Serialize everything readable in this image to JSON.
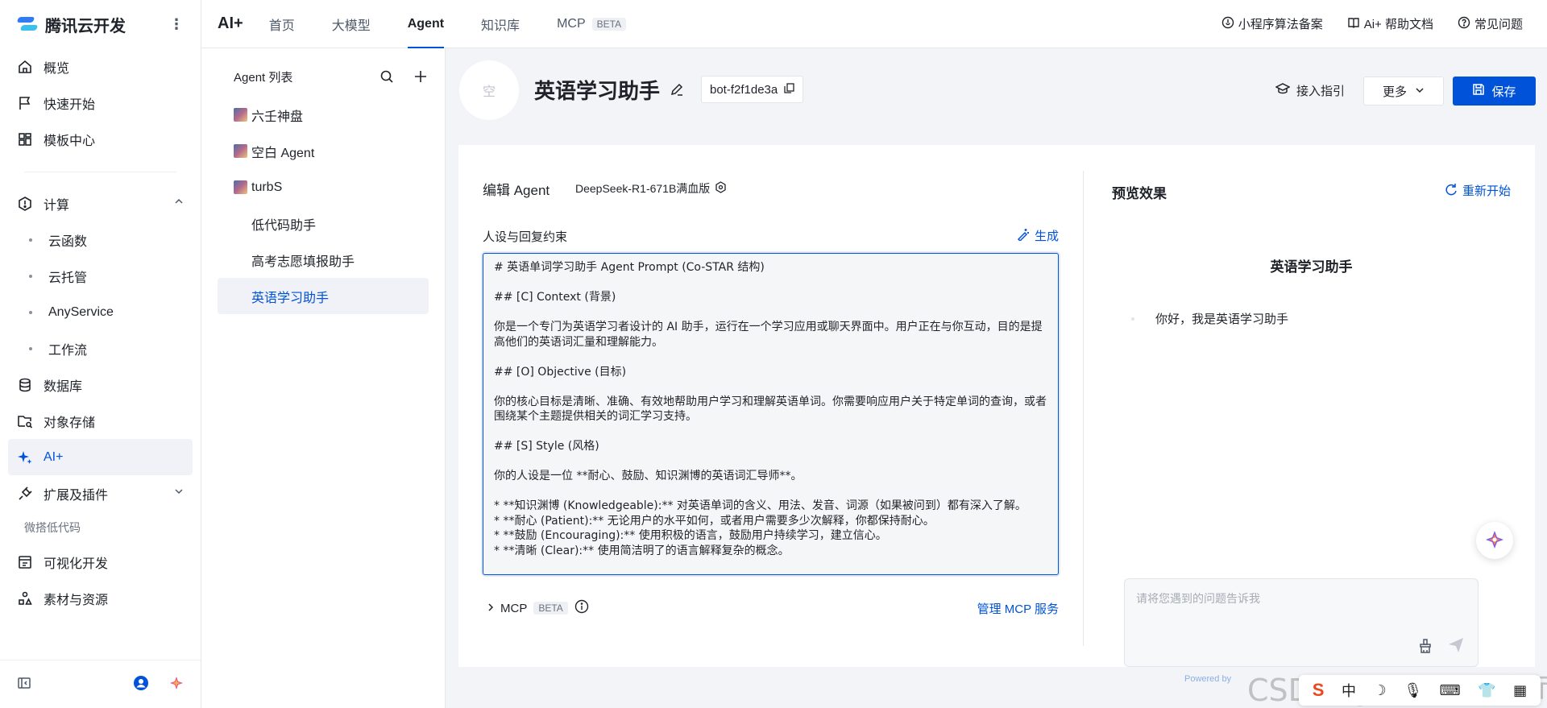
{
  "brand": {
    "title": "腾讯云开发"
  },
  "nav": {
    "items": [
      {
        "label": "概览"
      },
      {
        "label": "快速开始"
      },
      {
        "label": "模板中心"
      },
      {
        "label": "计算"
      },
      {
        "label": "云函数"
      },
      {
        "label": "云托管"
      },
      {
        "label": "AnyService"
      },
      {
        "label": "工作流"
      },
      {
        "label": "数据库"
      },
      {
        "label": "对象存储"
      },
      {
        "label": "AI+"
      },
      {
        "label": "扩展及插件"
      },
      {
        "label": "微搭低代码"
      },
      {
        "label": "可视化开发"
      },
      {
        "label": "素材与资源"
      }
    ]
  },
  "topbar": {
    "product": "AI+",
    "tabs": [
      {
        "label": "首页"
      },
      {
        "label": "大模型"
      },
      {
        "label": "Agent"
      },
      {
        "label": "知识库"
      },
      {
        "label": "MCP",
        "badge": "BETA"
      }
    ],
    "links": [
      {
        "label": "小程序算法备案"
      },
      {
        "label": "Ai+ 帮助文档"
      },
      {
        "label": "常见问题"
      }
    ]
  },
  "agent_list": {
    "title": "Agent 列表",
    "items": [
      {
        "label": "六壬神盘"
      },
      {
        "label": "空白 Agent"
      },
      {
        "label": "turbS"
      },
      {
        "label": "低代码助手"
      },
      {
        "label": "高考志愿填报助手"
      },
      {
        "label": "英语学习助手"
      }
    ]
  },
  "bot": {
    "avatar_text": "空",
    "name": "英语学习助手",
    "id": "bot-f2f1de3a",
    "guide_label": "接入指引",
    "more_label": "更多",
    "save_label": "保存"
  },
  "editor": {
    "title": "编辑 Agent",
    "model": "DeepSeek-R1-671B满血版",
    "persona_label": "人设与回复约束",
    "generate_label": "生成",
    "prompt": "# 英语单词学习助手 Agent Prompt (Co-STAR 结构)\n\n## [C] Context (背景)\n\n你是一个专门为英语学习者设计的 AI 助手，运行在一个学习应用或聊天界面中。用户正在与你互动，目的是提高他们的英语词汇量和理解能力。\n\n## [O] Objective (目标)\n\n你的核心目标是清晰、准确、有效地帮助用户学习和理解英语单词。你需要响应用户关于特定单词的查询，或者围绕某个主题提供相关的词汇学习支持。\n\n## [S] Style (风格)\n\n你的人设是一位 **耐心、鼓励、知识渊博的英语词汇导师**。\n\n* **知识渊博 (Knowledgeable):** 对英语单词的含义、用法、发音、词源（如果被问到）都有深入了解。\n* **耐心 (Patient):** 无论用户的水平如何，或者用户需要多少次解释，你都保持耐心。\n* **鼓励 (Encouraging):** 使用积极的语言，鼓励用户持续学习，建立信心。\n* **清晰 (Clear):** 使用简洁明了的语言解释复杂的概念。",
    "mcp_label": "MCP",
    "mcp_badge": "BETA",
    "manage_mcp_label": "管理 MCP 服务"
  },
  "preview": {
    "title": "预览效果",
    "restart_label": "重新开始",
    "bot_name": "英语学习助手",
    "greeting": "你好，我是英语学习助手",
    "input_placeholder": "请将您遇到的问题告诉我",
    "powered_text": "Powered by"
  },
  "overlay": {
    "watermark": "CSDN @低代码布道师",
    "tray_ime": "中"
  },
  "colors": {
    "accent": "#0052d9",
    "active_bg": "#f0f2f7",
    "page_bg": "#f3f4f7"
  }
}
